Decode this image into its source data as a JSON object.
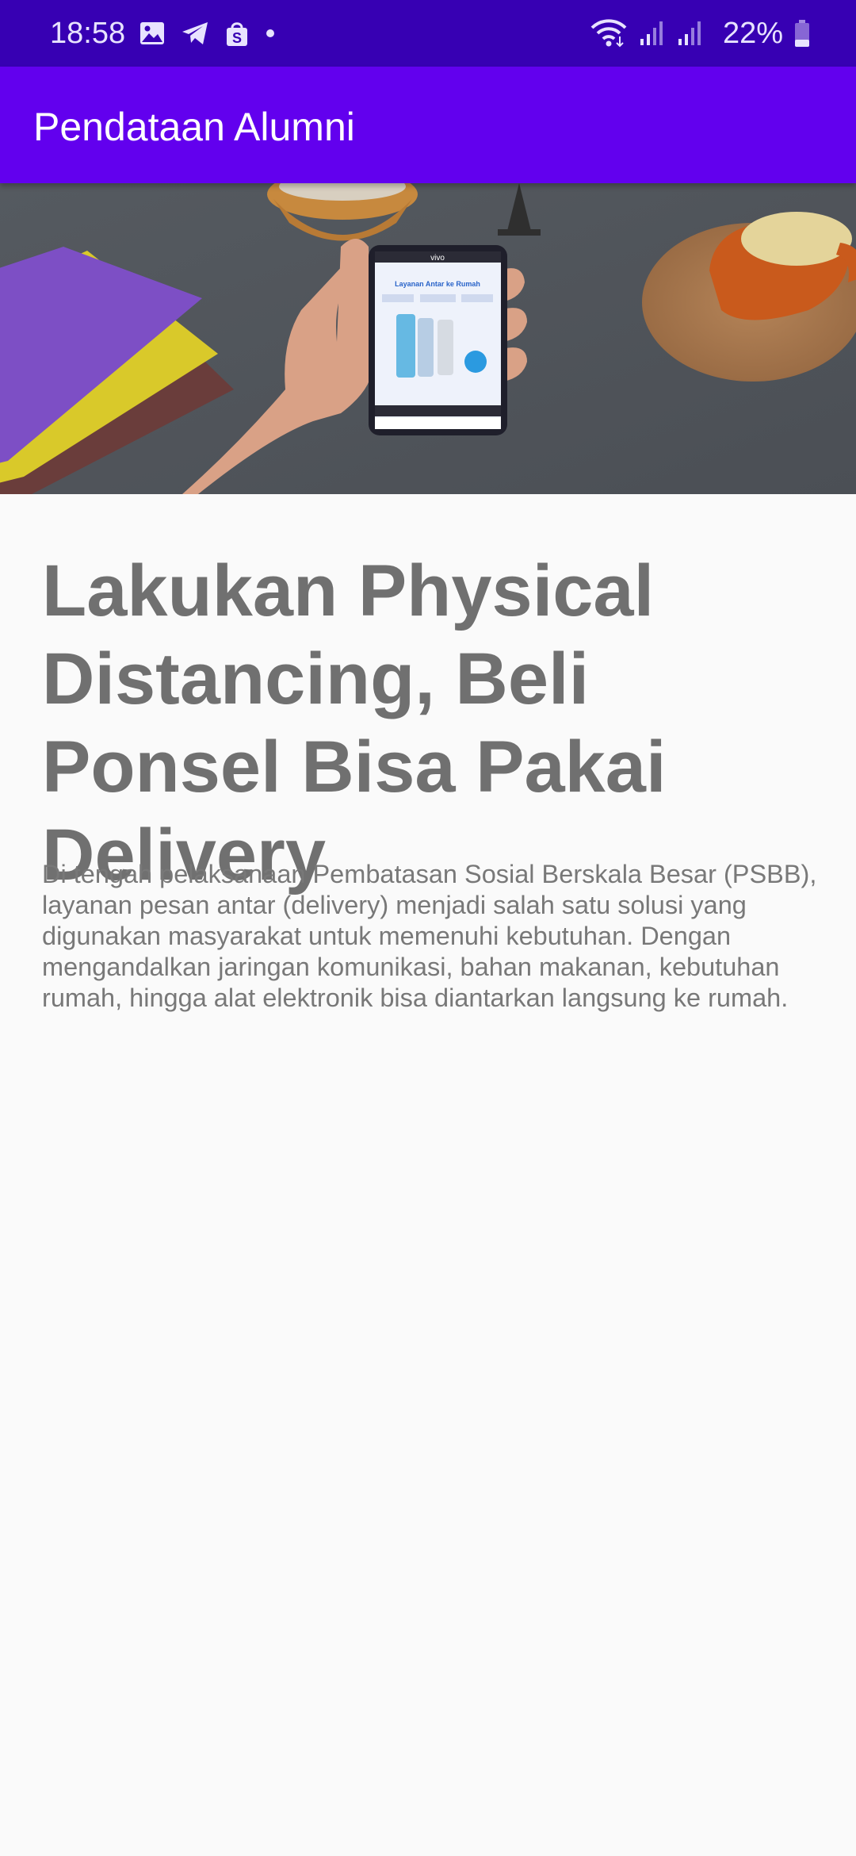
{
  "status_bar": {
    "time": "18:58",
    "battery": "22%",
    "left_icons": [
      "gallery-icon",
      "telegram-icon",
      "shopee-icon",
      "dot-icon"
    ],
    "right_icons": [
      "wifi-icon",
      "signal-icon",
      "signal-icon",
      "battery-icon"
    ],
    "colors": {
      "background": "#3700b3",
      "text": "#e8e3ff"
    }
  },
  "app_bar": {
    "title": "Pendataan Alumni",
    "color": "#6200ee"
  },
  "article": {
    "title": "Lakukan Physical Distancing, Beli Ponsel Bisa Pakai Delivery",
    "body": "Di tengah pelaksanaan Pembatasan Sosial Berskala Besar (PSBB), layanan pesan antar (delivery) menjadi salah satu solusi yang digunakan masyarakat untuk memenuhi kebutuhan. Dengan mengandalkan jaringan komunikasi, bahan makanan, kebutuhan rumah, hingga alat elektronik bisa diantarkan langsung ke rumah."
  },
  "hero_image": {
    "phone_brand": "vivo",
    "phone_headline": "Layanan Antar ke Rumah"
  }
}
